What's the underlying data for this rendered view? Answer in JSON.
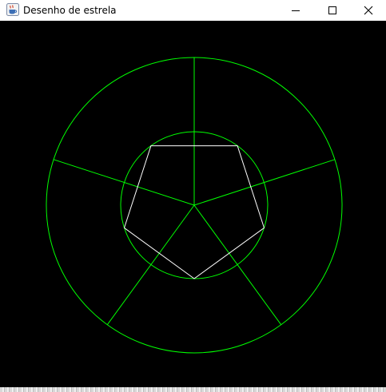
{
  "window": {
    "title": "Desenho de estrela",
    "icon": "java-cup-icon",
    "controls": [
      "minimize-icon",
      "maximize-icon",
      "close-icon"
    ]
  },
  "drawing": {
    "background_color": "#000000",
    "circle_color": "#00ff00",
    "spoke_color": "#00ff00",
    "pentagon_color": "#ffffff",
    "spoke_count": 5,
    "pentagon_sides": 5
  }
}
